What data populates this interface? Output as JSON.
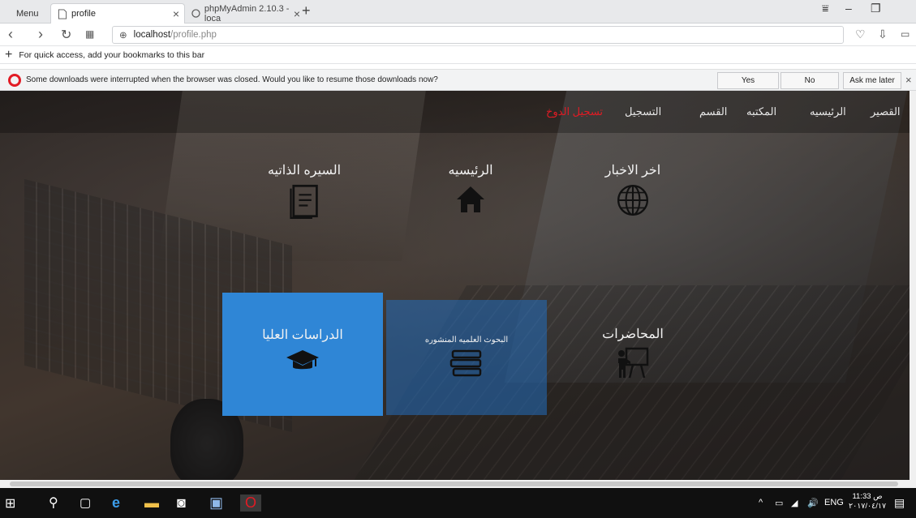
{
  "browser": {
    "menu_label": "Menu",
    "tabs": [
      {
        "title": "profile"
      },
      {
        "title": "phpMyAdmin 2.10.3 - loca"
      }
    ],
    "new_tab": "+",
    "address": {
      "host": "localhost",
      "path": "/profile.php"
    },
    "bookmarks_hint": "For quick access, add your bookmarks to this bar",
    "notification": {
      "message": "Some downloads were interrupted when the browser was closed. Would you like to resume those downloads now?",
      "yes": "Yes",
      "no": "No",
      "later": "Ask me later"
    }
  },
  "page": {
    "nav": [
      {
        "label": "القصير"
      },
      {
        "label": "الرئيسيه"
      },
      {
        "label": "المكتبه"
      },
      {
        "label": "القسم"
      },
      {
        "label": "التسجيل"
      },
      {
        "label": "تسجيل الدوخ"
      }
    ],
    "tiles": [
      {
        "title": "اخر الاخبار",
        "icon": "globe-icon"
      },
      {
        "title": "الرئيسيه",
        "icon": "home-icon"
      },
      {
        "title": "السيره الذاتيه",
        "icon": "document-icon"
      },
      {
        "title": "المحاضرات",
        "icon": "presentation-icon"
      },
      {
        "title": "البحوث العلميه المنشوره",
        "icon": "books-icon"
      },
      {
        "title": "الدراسات العليا",
        "icon": "graduation-cap-icon"
      }
    ]
  },
  "taskbar": {
    "lang": "ENG",
    "time": "11:33 ص",
    "date": "٢٠١٧/٠٤/١٧"
  },
  "colors": {
    "tile_blue": "#2f86d6",
    "active_nav": "#e21b24",
    "opera_red": "#e21b24"
  }
}
